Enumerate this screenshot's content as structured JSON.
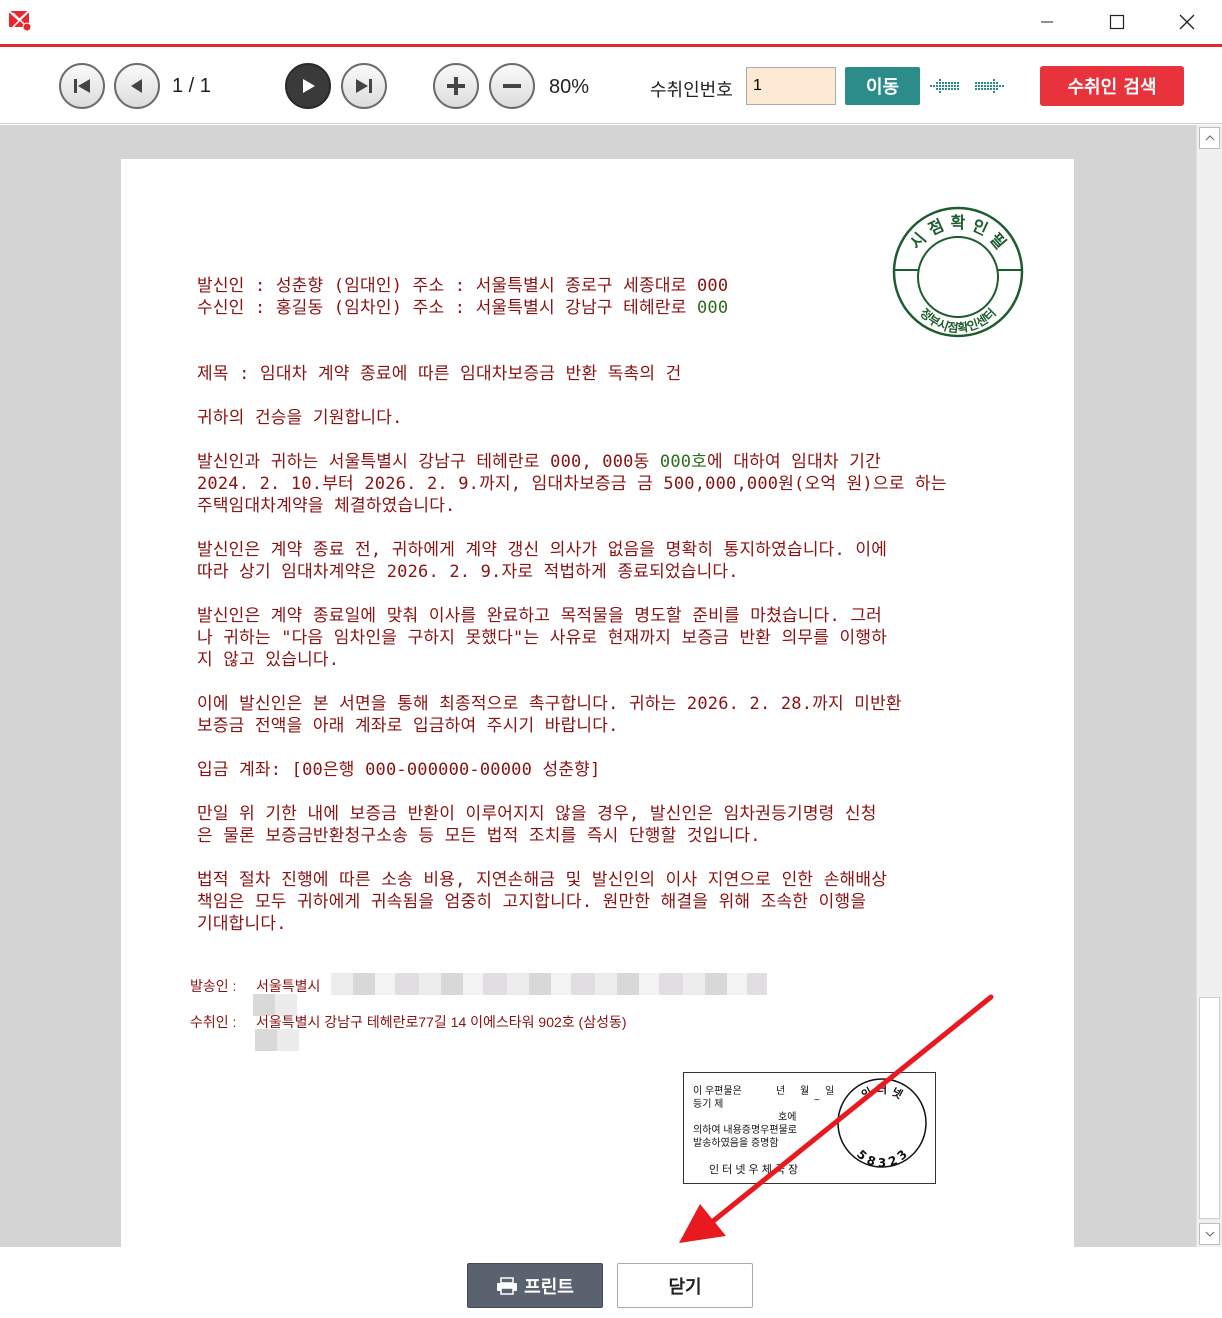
{
  "titlebar": {
    "minimize_symbol": "—",
    "close_symbol": "✕"
  },
  "toolbar": {
    "page_indicator": "1 / 1",
    "zoom_level": "80%",
    "recipient_label": "수취인번호",
    "recipient_value": "1",
    "go_button": "이동",
    "search_button": "수취인 검색"
  },
  "document": {
    "sender_line": "발신인 : 성춘향 (임대인) 주소 : 서울특별시 종로구 세종대로 000",
    "recipient_line_main": "수신인 : 홍길동 (임차인) 주소 : 서울특별시 강남구 테헤란로 ",
    "recipient_line_num": "000",
    "subject": "제목 : 임대차 계약 종료에 따른 임대차보증금 반환 독촉의 건",
    "greeting": "귀하의 건승을 기원합니다.",
    "para1_a": "발신인과 귀하는 서울특별시 강남구 테헤란로 000, 000동 ",
    "para1_b": "000호",
    "para1_c": "에 대하여 임대차 기간",
    "para1_d": "2024. 2. 10.부터 2026. 2. 9.까지, 임대차보증금 금 500,000,000원(오억 원)으로 하는",
    "para1_e": "주택임대차계약을 체결하였습니다.",
    "para2_a": "발신인은 계약 종료 전, 귀하에게 계약 갱신 의사가 없음을 명확히 통지하였습니다. 이에",
    "para2_b": "따라 상기 임대차계약은 2026. 2. 9.자로 적법하게 종료되었습니다.",
    "para3_a": "발신인은 계약 종료일에 맞춰 이사를 완료하고 목적물을 명도할 준비를 마쳤습니다. 그러",
    "para3_b": "나 귀하는 \"다음 임차인을 구하지 못했다\"는 사유로 현재까지 보증금 반환 의무를 이행하",
    "para3_c": "지 않고 있습니다.",
    "para4_a": "이에 발신인은 본 서면을 통해 최종적으로 촉구합니다. 귀하는 2026. 2. 28.까지 미반환",
    "para4_b": "보증금 전액을 아래 계좌로 입금하여 주시기 바랍니다.",
    "account": "입금 계좌: [00은행 000-000000-00000 성춘향]",
    "para5_a": "만일 위 기한 내에 보증금 반환이 이루어지지 않을 경우, 발신인은 임차권등기명령 신청",
    "para5_b": "은 물론 보증금반환청구소송 등 모든 법적 조치를 즉시 단행할 것입니다.",
    "para6_a": "법적 절차 진행에 따른 소송 비용, 지연손해금 및 발신인의 이사 지연으로 인한 손해배상",
    "para6_b": "책임은 모두 귀하에게 귀속됨을 엄중히 고지합니다. 원만한 해결을 위해 조속한 이행을",
    "para6_c": "기대합니다.",
    "dispatcher_label": "발송인 :",
    "dispatcher_value": "서울특별시",
    "receiver_label": "수취인 :",
    "receiver_value": "서울특별시 강남구 테헤란로77길 14 이에스타워 902호 (삼성동)"
  },
  "seal": {
    "top_text": "시 점 확 인 필",
    "bottom_text": "정부시점확인센터"
  },
  "postmark": {
    "line1_a": "이 우편물은",
    "line1_b": "년",
    "line1_c": "월",
    "line1_d": "일",
    "line2_a": "등기 제",
    "line2_b": "~",
    "line3": "호에",
    "line4": "의하여 내용증명우편물로",
    "line5": "발송하였음을 증명함",
    "line6": "인 터 넷 우 체 국 장",
    "stamp_top": "인 터 넷",
    "stamp_code": "5 8 3 2 3"
  },
  "bottom": {
    "print_button": "프린트",
    "close_button": "닫기"
  },
  "colors": {
    "accent_red": "#e8262d",
    "go_teal": "#2b8c8a",
    "search_red": "#e8323c",
    "doc_text": "#8a1212",
    "seal_green": "#1d5c2e"
  }
}
